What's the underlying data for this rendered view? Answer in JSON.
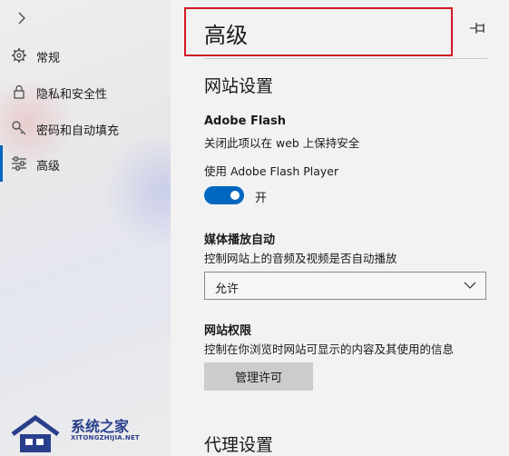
{
  "sidebar": {
    "items": [
      {
        "label": "常规",
        "icon": "gear-icon"
      },
      {
        "label": "隐私和安全性",
        "icon": "lock-icon"
      },
      {
        "label": "密码和自动填充",
        "icon": "key-icon"
      },
      {
        "label": "高级",
        "icon": "sliders-icon",
        "active": true
      }
    ]
  },
  "header": {
    "title": "高级"
  },
  "site_settings": {
    "heading": "网站设置",
    "flash": {
      "title": "Adobe Flash",
      "description": "关闭此项以在 web 上保持安全",
      "toggle_caption": "使用 Adobe Flash Player",
      "toggle_state_label": "开",
      "toggle_on": true
    },
    "autoplay": {
      "title": "媒体播放自动",
      "description": "控制网站上的音频及视频是否自动播放",
      "selected": "允许"
    },
    "permissions": {
      "title": "网站权限",
      "description": "控制在你浏览时网站可显示的内容及其使用的信息",
      "button_label": "管理许可"
    }
  },
  "proxy": {
    "heading": "代理设置"
  },
  "watermark": {
    "name": "系统之家",
    "domain": "XITONGZHIJIA.NET"
  },
  "colors": {
    "accent": "#0067c0",
    "highlight_border": "#d01822",
    "watermark": "#2a3f8c"
  }
}
